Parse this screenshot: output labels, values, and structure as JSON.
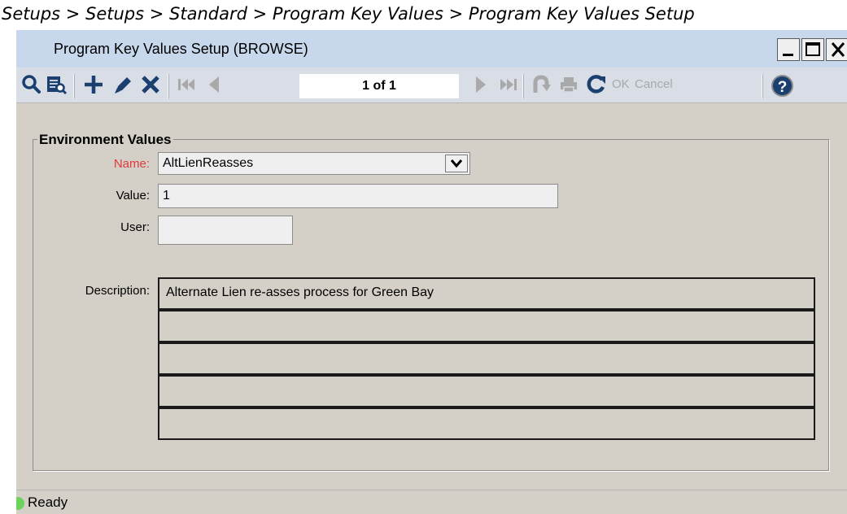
{
  "breadcrumb": "Setups > Setups > Standard > Program Key Values > Program Key Values Setup",
  "window": {
    "title": "Program Key Values Setup (BROWSE)"
  },
  "toolbar": {
    "record_position": "1 of 1",
    "ok_label": "OK",
    "cancel_label": "Cancel",
    "help_label": "?",
    "icons": [
      "search-icon",
      "browse-list-icon",
      "add-icon",
      "edit-icon",
      "delete-icon",
      "first-record-icon",
      "previous-record-icon",
      "next-record-icon",
      "last-record-icon",
      "undo-icon",
      "print-icon",
      "refresh-icon",
      "help-icon"
    ]
  },
  "form": {
    "group_title": "Environment Values",
    "name_label": "Name:",
    "name_value": "AltLienReasses",
    "value_label": "Value:",
    "value_value": "1",
    "user_label": "User:",
    "user_value": "",
    "description_label": "Description:",
    "description_lines": [
      "Alternate Lien re-asses process for Green Bay",
      "",
      "",
      "",
      ""
    ]
  },
  "status": {
    "text": "Ready",
    "indicator_color": "#6ed35c"
  },
  "colors": {
    "titlebar": "#c7d7ec",
    "toolbar_icon": "#1b3f6e",
    "required_label": "#e0393a",
    "disabled_icon": "#a9a9a9"
  }
}
